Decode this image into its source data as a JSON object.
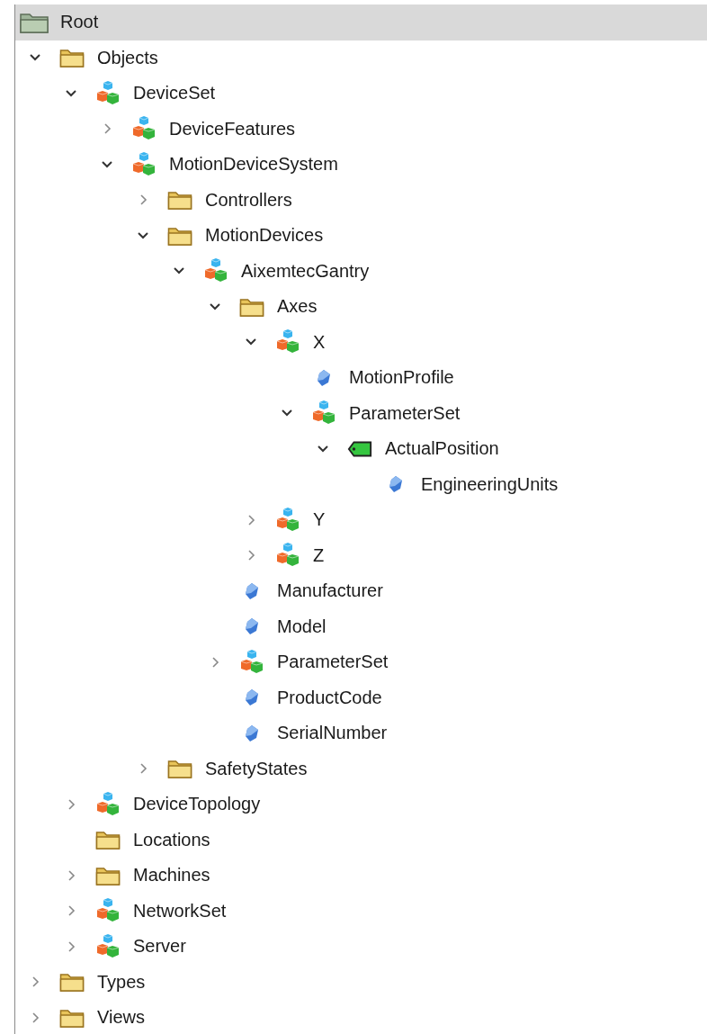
{
  "tree": {
    "label": "Root",
    "kind": "root-folder",
    "selected": true,
    "children": [
      {
        "label": "Objects",
        "kind": "folder",
        "selected": false,
        "expanded": true,
        "children": [
          {
            "label": "DeviceSet",
            "kind": "object",
            "selected": false,
            "expanded": true,
            "children": [
              {
                "label": "DeviceFeatures",
                "kind": "object",
                "selected": false,
                "expanded": false
              },
              {
                "label": "MotionDeviceSystem",
                "kind": "object",
                "selected": false,
                "expanded": true,
                "children": [
                  {
                    "label": "Controllers",
                    "kind": "folder",
                    "selected": false,
                    "expanded": false
                  },
                  {
                    "label": "MotionDevices",
                    "kind": "folder",
                    "selected": false,
                    "expanded": true,
                    "children": [
                      {
                        "label": "AixemtecGantry",
                        "kind": "object",
                        "selected": false,
                        "expanded": true,
                        "children": [
                          {
                            "label": "Axes",
                            "kind": "folder",
                            "selected": false,
                            "expanded": true,
                            "children": [
                              {
                                "label": "X",
                                "kind": "object",
                                "selected": false,
                                "expanded": true,
                                "children": [
                                  {
                                    "label": "MotionProfile",
                                    "kind": "property",
                                    "selected": false
                                  },
                                  {
                                    "label": "ParameterSet",
                                    "kind": "object",
                                    "selected": false,
                                    "expanded": true,
                                    "children": [
                                      {
                                        "label": "ActualPosition",
                                        "kind": "variable",
                                        "selected": false,
                                        "expanded": true,
                                        "children": [
                                          {
                                            "label": "EngineeringUnits",
                                            "kind": "property",
                                            "selected": false
                                          }
                                        ]
                                      }
                                    ]
                                  }
                                ]
                              },
                              {
                                "label": "Y",
                                "kind": "object",
                                "selected": false,
                                "expanded": false
                              },
                              {
                                "label": "Z",
                                "kind": "object",
                                "selected": false,
                                "expanded": false
                              }
                            ]
                          },
                          {
                            "label": "Manufacturer",
                            "kind": "property",
                            "selected": false
                          },
                          {
                            "label": "Model",
                            "kind": "property",
                            "selected": false
                          },
                          {
                            "label": "ParameterSet",
                            "kind": "object",
                            "selected": false,
                            "expanded": false
                          },
                          {
                            "label": "ProductCode",
                            "kind": "property",
                            "selected": false
                          },
                          {
                            "label": "SerialNumber",
                            "kind": "property",
                            "selected": false
                          }
                        ]
                      }
                    ]
                  },
                  {
                    "label": "SafetyStates",
                    "kind": "folder",
                    "selected": false,
                    "expanded": false
                  }
                ]
              }
            ]
          },
          {
            "label": "DeviceTopology",
            "kind": "object",
            "selected": false,
            "expanded": false
          },
          {
            "label": "Locations",
            "kind": "folder",
            "selected": false
          },
          {
            "label": "Machines",
            "kind": "folder",
            "selected": false,
            "expanded": false
          },
          {
            "label": "NetworkSet",
            "kind": "object",
            "selected": false,
            "expanded": false
          },
          {
            "label": "Server",
            "kind": "object",
            "selected": false,
            "expanded": false
          }
        ]
      },
      {
        "label": "Types",
        "kind": "folder",
        "selected": false,
        "expanded": false
      },
      {
        "label": "Views",
        "kind": "folder",
        "selected": false,
        "expanded": false
      }
    ]
  }
}
